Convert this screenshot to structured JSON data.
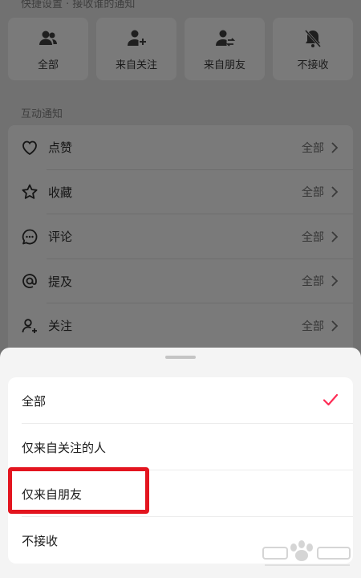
{
  "quick_settings": {
    "title": "快捷设置 · 接收谁的通知",
    "items": [
      {
        "label": "全部",
        "icon": "group-icon"
      },
      {
        "label": "来自关注",
        "icon": "user-add-icon"
      },
      {
        "label": "来自朋友",
        "icon": "user-swap-icon"
      },
      {
        "label": "不接收",
        "icon": "bell-off-icon"
      }
    ]
  },
  "interaction": {
    "title": "互动通知",
    "items": [
      {
        "label": "点赞",
        "value": "全部",
        "icon": "heart-icon"
      },
      {
        "label": "收藏",
        "value": "全部",
        "icon": "star-icon"
      },
      {
        "label": "评论",
        "value": "全部",
        "icon": "comment-icon"
      },
      {
        "label": "提及",
        "value": "全部",
        "icon": "at-icon"
      },
      {
        "label": "关注",
        "value": "全部",
        "icon": "user-plus-icon"
      }
    ]
  },
  "sheet": {
    "options": [
      {
        "label": "全部",
        "selected": true
      },
      {
        "label": "仅来自关注的人",
        "selected": false
      },
      {
        "label": "仅来自朋友",
        "selected": false
      },
      {
        "label": "不接收",
        "selected": false
      }
    ]
  },
  "colors": {
    "accent": "#fe2c55",
    "highlight": "#e3151f"
  }
}
